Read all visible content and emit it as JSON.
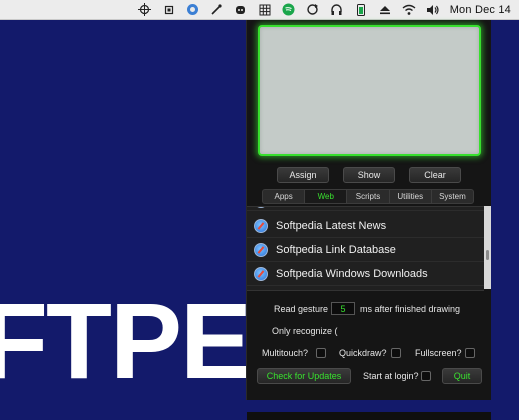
{
  "menubar": {
    "icons": [
      "crosshair-icon",
      "chip-icon",
      "globe-icon",
      "wand-icon",
      "robot-icon",
      "grid-icon",
      "spotify-icon",
      "sync-icon",
      "headphones-icon",
      "battery-icon",
      "eject-icon",
      "wifi-icon",
      "volume-icon"
    ],
    "clock": "Mon Dec 14"
  },
  "wallpaper": {
    "text": "FTPE"
  },
  "panel": {
    "buttons": {
      "assign": "Assign",
      "show": "Show",
      "clear": "Clear"
    },
    "tabs": [
      {
        "label": "Apps",
        "active": false
      },
      {
        "label": "Web",
        "active": true
      },
      {
        "label": "Scripts",
        "active": false
      },
      {
        "label": "Utilities",
        "active": false
      },
      {
        "label": "System",
        "active": false
      }
    ],
    "list": [
      "Softpedia Latest News",
      "Softpedia Link Database",
      "Softpedia Windows Downloads"
    ],
    "settings": {
      "read_gesture_label": "Read gesture",
      "read_gesture_value": "5",
      "after_label": "ms after finished drawing",
      "only_recognize_label": "Only recognize (",
      "multitouch_label": "Multitouch?",
      "quickdraw_label": "Quickdraw?",
      "fullscreen_label": "Fullscreen?",
      "check_updates_label": "Check for Updates",
      "start_login_label": "Start at login?",
      "quit_label": "Quit"
    },
    "accent_color": "#39e12f"
  }
}
